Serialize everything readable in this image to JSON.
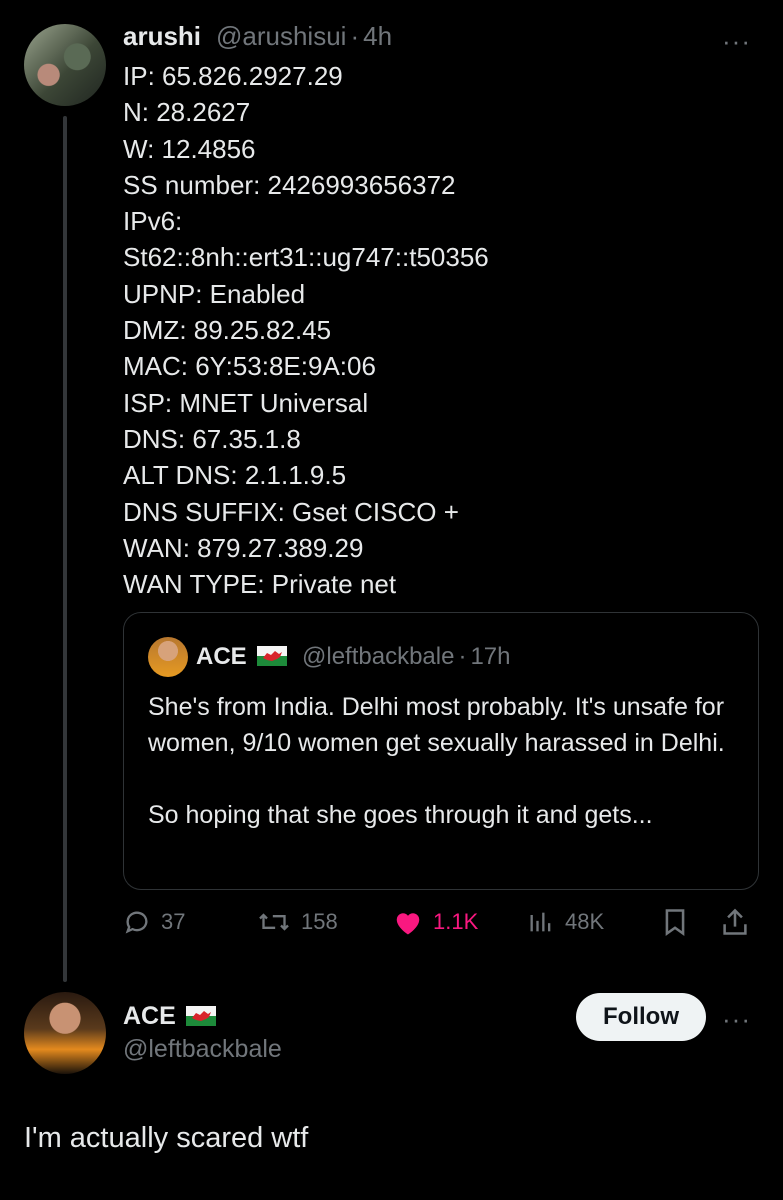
{
  "tweet": {
    "name": "arushi",
    "handle": "@arushisui",
    "separator": "·",
    "time": "4h",
    "more": "···",
    "body_lines": [
      "IP: 65.826.2927.29",
      "N: 28.2627",
      "W: 12.4856",
      "SS number: 2426993656372",
      "IPv6:",
      "St62::8nh::ert31::ug747::t50356",
      "UPNP: Enabled",
      "DMZ: 89.25.82.45",
      "MAC: 6Y:53:8E:9A:06",
      "ISP: MNET Universal",
      "DNS: 67.35.1.8",
      "ALT DNS: 2.1.1.9.5",
      "DNS SUFFIX: Gset CISCO +",
      "WAN: 879.27.389.29",
      "WAN TYPE: Private net"
    ],
    "quote": {
      "name": "ACE",
      "flag_icon": "wales-flag-icon",
      "handle": "@leftbackbale",
      "separator": "·",
      "time": "17h",
      "para1": "She's from India. Delhi most probably. It's unsafe for women, 9/10 women get sexually harassed in Delhi.",
      "para2": "So hoping that she goes through it and gets..."
    },
    "actions": {
      "replies": "37",
      "reposts": "158",
      "likes": "1.1K",
      "views": "48K"
    }
  },
  "reply": {
    "name": "ACE",
    "flag_icon": "wales-flag-icon",
    "handle": "@leftbackbale",
    "follow_label": "Follow",
    "more": "···",
    "text": "I'm actually scared wtf"
  },
  "colors": {
    "background": "#000000",
    "text": "#e7e9ea",
    "muted": "#71767b",
    "like": "#f91880",
    "border": "#2f3336"
  }
}
